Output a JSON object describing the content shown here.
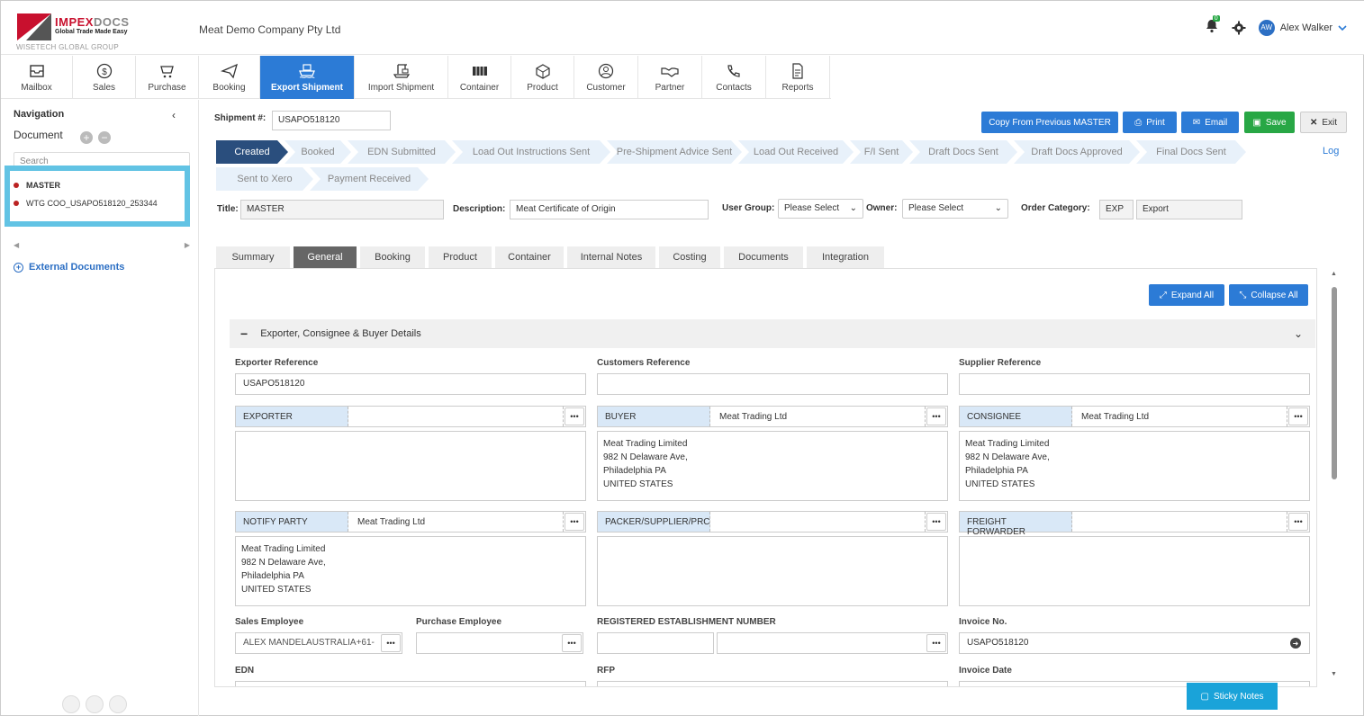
{
  "header": {
    "logo_brand_a": "IMPEX",
    "logo_brand_b": "DOCS",
    "logo_tagline": "Global Trade Made Easy",
    "logo_group": "WISETECH GLOBAL GROUP",
    "company": "Meat Demo Company Pty Ltd",
    "notification_count": "0",
    "user_initials": "AW",
    "user_name": "Alex Walker"
  },
  "modules": [
    {
      "label": "Mailbox",
      "icon": "mailbox-icon"
    },
    {
      "label": "Sales",
      "icon": "dollar-icon"
    },
    {
      "label": "Purchase",
      "icon": "cart-icon"
    },
    {
      "label": "Booking",
      "icon": "paper-plane-icon"
    },
    {
      "label": "Export Shipment",
      "icon": "ship-icon"
    },
    {
      "label": "Import Shipment",
      "icon": "crane-icon"
    },
    {
      "label": "Container",
      "icon": "container-icon"
    },
    {
      "label": "Product",
      "icon": "box-icon"
    },
    {
      "label": "Customer",
      "icon": "customer-icon"
    },
    {
      "label": "Partner",
      "icon": "handshake-icon"
    },
    {
      "label": "Contacts",
      "icon": "phone-icon"
    },
    {
      "label": "Reports",
      "icon": "report-icon"
    }
  ],
  "nav": {
    "title": "Navigation",
    "collapse": "‹",
    "document_label": "Document",
    "search_placeholder": "Search",
    "tree": [
      {
        "label": "MASTER",
        "bold": true
      },
      {
        "label": "WTG COO_USAPO518120_253344",
        "bold": false
      }
    ],
    "external_documents": "External Documents"
  },
  "shipment": {
    "label": "Shipment #:",
    "value": "USAPO518120"
  },
  "actions": {
    "copy": "Copy From Previous MASTER",
    "print": "Print",
    "email": "Email",
    "save": "Save",
    "exit": "Exit"
  },
  "statuses_row1": [
    "Created",
    "Booked",
    "EDN Submitted",
    "Load Out Instructions Sent",
    "Pre-Shipment Advice Sent",
    "Load Out Received",
    "F/I Sent",
    "Draft Docs Sent",
    "Draft Docs Approved",
    "Final Docs Sent"
  ],
  "statuses_row2": [
    "Sent to Xero",
    "Payment Received"
  ],
  "log_link": "Log",
  "form": {
    "title_label": "Title:",
    "title_value": "MASTER",
    "description_label": "Description:",
    "description_value": "Meat Certificate of Origin",
    "user_group_label": "User Group:",
    "user_group_value": "Please Select",
    "owner_label": "Owner:",
    "owner_value": "Please Select",
    "order_category_label": "Order Category:",
    "order_category_code": "EXP",
    "order_category_value": "Export"
  },
  "tabs": [
    "Summary",
    "General",
    "Booking",
    "Product",
    "Container",
    "Internal Notes",
    "Costing",
    "Documents",
    "Integration"
  ],
  "panel": {
    "expand_all": "Expand All",
    "collapse_all": "Collapse All",
    "section_title": "Exporter, Consignee & Buyer Details",
    "exporter_reference_label": "Exporter Reference",
    "exporter_reference_value": "USAPO518120",
    "customers_reference_label": "Customers Reference",
    "supplier_reference_label": "Supplier Reference",
    "exporter_tag": "EXPORTER",
    "exporter_value": "",
    "exporter_address": "",
    "buyer_tag": "BUYER",
    "buyer_value": "Meat Trading Ltd",
    "buyer_address": "Meat Trading Limited\n982 N Delaware Ave,\nPhiladelphia PA\nUNITED STATES",
    "consignee_tag": "CONSIGNEE",
    "consignee_value": "Meat Trading Ltd",
    "consignee_address": "Meat Trading Limited\n982 N Delaware Ave,\nPhiladelphia PA\nUNITED STATES",
    "notify_tag": "NOTIFY PARTY",
    "notify_value": "Meat Trading Ltd",
    "notify_address": "Meat Trading Limited\n982 N Delaware Ave,\nPhiladelphia PA\nUNITED STATES",
    "packer_tag": "PACKER/SUPPLIER/PRC",
    "packer_value": "",
    "freight_tag": "FREIGHT FORWARDER",
    "freight_value": "",
    "sales_employee_label": "Sales Employee",
    "sales_employee_value": "ALEX MANDELAUSTRALIA+61-",
    "purchase_employee_label": "Purchase Employee",
    "reg_est_label": "REGISTERED ESTABLISHMENT NUMBER",
    "invoice_no_label": "Invoice No.",
    "invoice_no_value": "USAPO518120",
    "edn_label": "EDN",
    "rfp_label": "RFP",
    "invoice_date_label": "Invoice Date",
    "dots": "•••"
  },
  "sticky_notes": "Sticky Notes",
  "colors": {
    "primary": "#2c7bd6",
    "dark_status": "#2a4e7d",
    "save_green": "#28a745",
    "brand_red": "#c8102e",
    "highlight": "#62c3e4"
  }
}
